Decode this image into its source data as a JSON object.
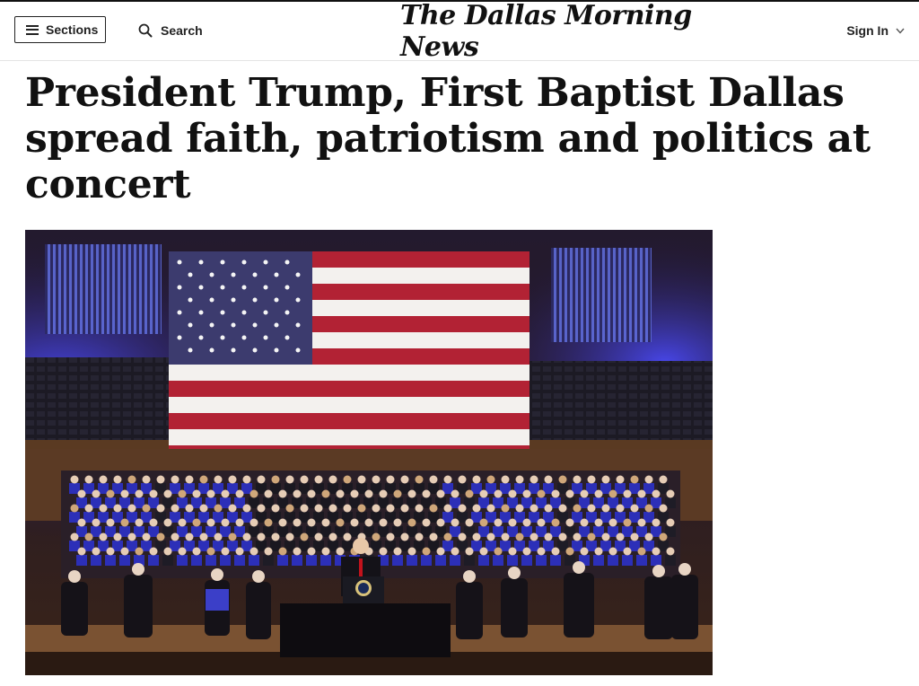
{
  "header": {
    "sections_label": "Sections",
    "search_label": "Search",
    "logo_text": "The Dallas Morning News",
    "signin_label": "Sign In"
  },
  "article": {
    "headline": "President Trump, First Baptist Dallas spread faith, patriotism and politics at concert",
    "photo_alt": "Concert stage with large American flag, choir and orchestra, and speaker at presidential podium",
    "caption": ""
  },
  "icons": {
    "menu": "hamburger-icon",
    "search": "search-icon",
    "dropdown": "chevron-down-icon"
  },
  "colors": {
    "text": "#111111",
    "border": "#222222",
    "stage_blue": "#3a3cd0",
    "flag_red": "#b22234",
    "flag_blue": "#3c3b6e"
  }
}
